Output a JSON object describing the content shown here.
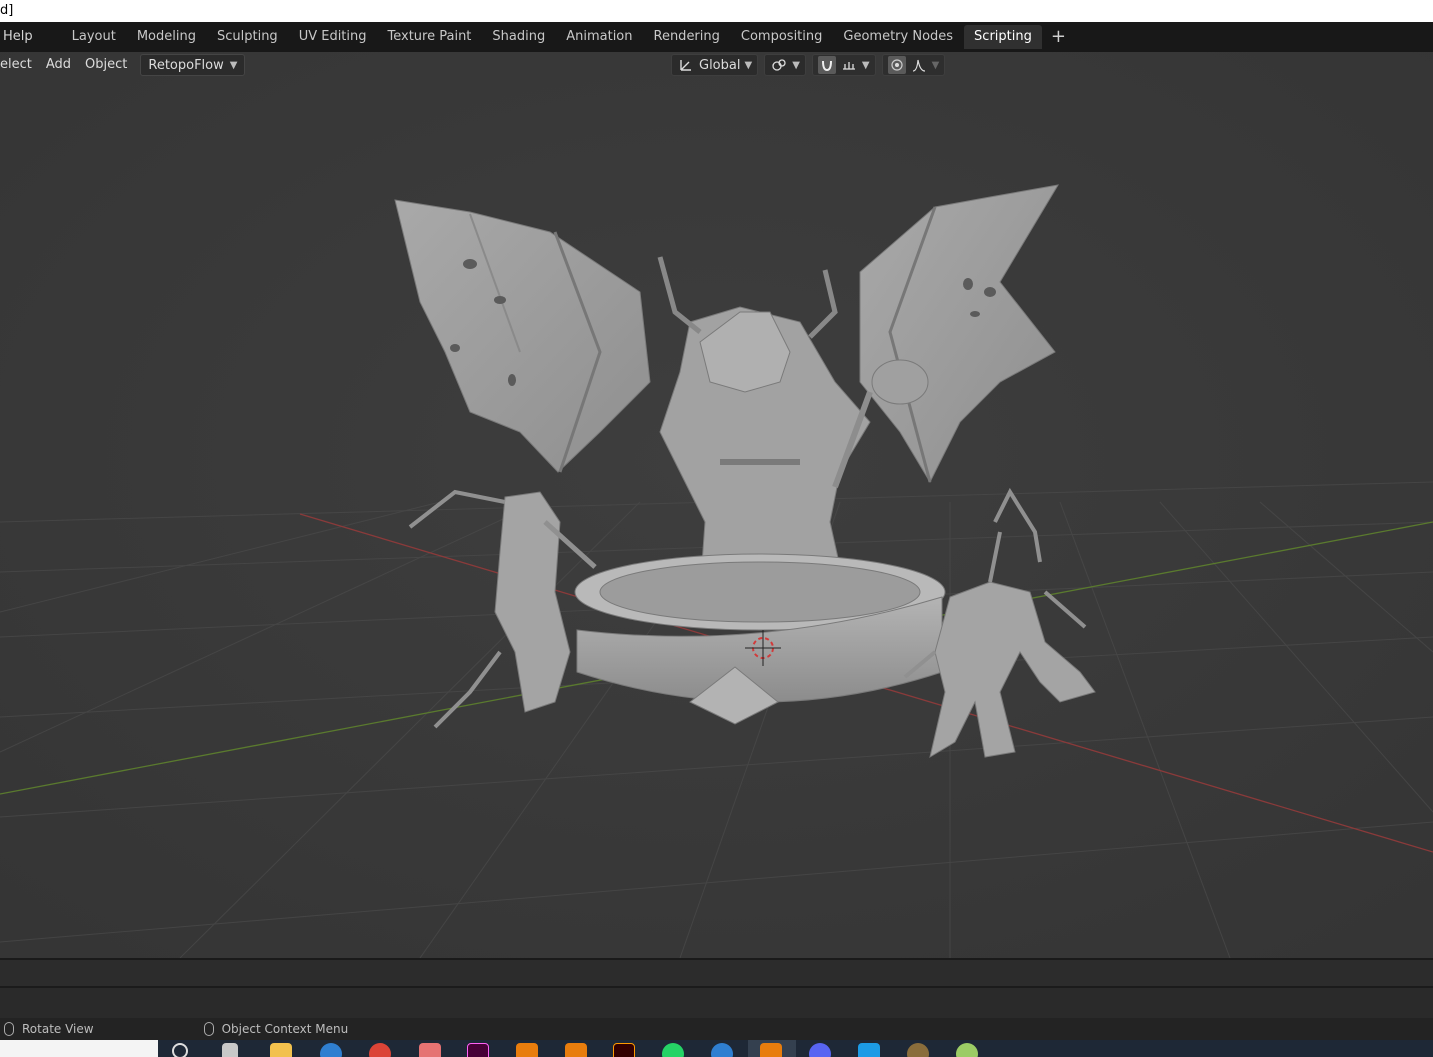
{
  "window": {
    "title_fragment": "d]"
  },
  "menu": {
    "help": "Help"
  },
  "workspace_tabs": [
    {
      "label": "Layout",
      "active": false
    },
    {
      "label": "Modeling",
      "active": false
    },
    {
      "label": "Sculpting",
      "active": false
    },
    {
      "label": "UV Editing",
      "active": false
    },
    {
      "label": "Texture Paint",
      "active": false
    },
    {
      "label": "Shading",
      "active": false
    },
    {
      "label": "Animation",
      "active": false
    },
    {
      "label": "Rendering",
      "active": false
    },
    {
      "label": "Compositing",
      "active": false
    },
    {
      "label": "Geometry Nodes",
      "active": false
    },
    {
      "label": "Scripting",
      "active": true
    }
  ],
  "add_workspace": "+",
  "viewport_header": {
    "select": "elect",
    "add": "Add",
    "object": "Object",
    "addon_menu": "RetopoFlow",
    "transform_orientation": "Global"
  },
  "status_bar": {
    "left_hint": "Rotate View",
    "right_hint": "Object Context Menu"
  },
  "colors": {
    "accent_active_tab": "#303030",
    "viewport_bg": "#393939",
    "grid": "#454545",
    "x_axis": "#8a3a3a",
    "y_axis": "#5a7a2e",
    "model": "#a6a6a6"
  },
  "taskbar_icons": [
    "search-icon",
    "task-view-icon",
    "file-explorer-icon",
    "app-icon",
    "chrome-icon",
    "app-icon",
    "xd-icon",
    "blender-icon",
    "blender-icon",
    "illustrator-icon",
    "whatsapp-icon",
    "app-icon",
    "blender-icon",
    "discord-icon",
    "app-icon",
    "app-icon",
    "app-icon"
  ]
}
